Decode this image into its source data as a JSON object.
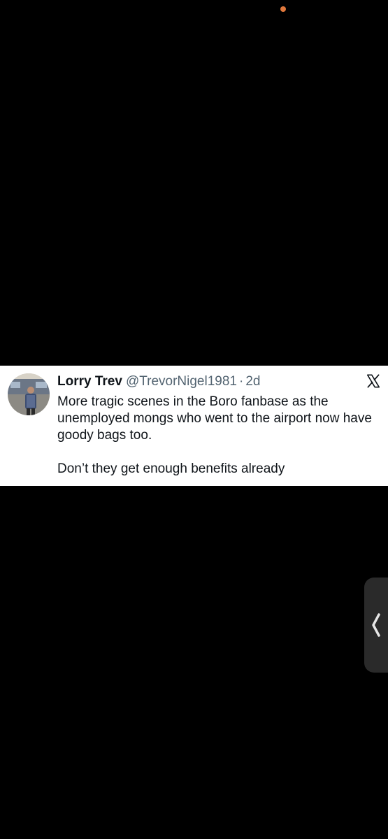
{
  "status_bar": {
    "indicator_color": "#e0783c"
  },
  "tweet": {
    "display_name": "Lorry Trev",
    "handle": "@TrevorNigel1981",
    "separator": "·",
    "time": "2d",
    "paragraphs": [
      "More tragic scenes in the Boro fanbase as the unemployed mongs who went to the airport now have goody bags too.",
      "Don’t they get enough benefits already"
    ],
    "platform_icon": "x-logo-icon"
  },
  "edge_panel": {
    "icon": "chevron-left-icon"
  }
}
